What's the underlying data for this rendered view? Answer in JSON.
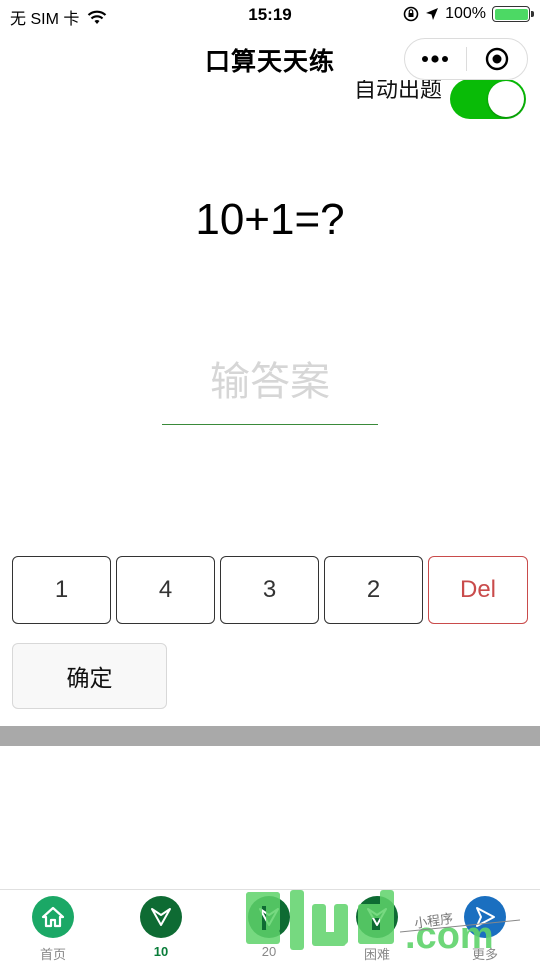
{
  "status_bar": {
    "carrier": "无 SIM 卡",
    "time": "15:19",
    "battery": "100%"
  },
  "nav": {
    "title": "口算天天练"
  },
  "auto_toggle": {
    "label": "自动出题",
    "on": true
  },
  "question": "10+1=?",
  "answer": {
    "value": "",
    "placeholder": "输答案"
  },
  "keypad": {
    "keys": [
      "1",
      "4",
      "3",
      "2"
    ],
    "del": "Del"
  },
  "confirm_label": "确定",
  "tabs": [
    {
      "label": "首页",
      "icon": "home-icon",
      "color": "#1ba866"
    },
    {
      "label": "10",
      "icon": "arrow-down-icon",
      "color": "#0e6b33"
    },
    {
      "label": "20",
      "icon": "arrow-down-icon",
      "color": "#0e6b33"
    },
    {
      "label": "困难",
      "icon": "arrow-down-icon",
      "color": "#0e6b33"
    },
    {
      "label": "更多",
      "icon": "send-icon",
      "color": "#1a6fc0"
    }
  ],
  "active_tab": "10",
  "watermark": {
    "text": ".com",
    "handwriting": "小程序"
  },
  "colors": {
    "switch_on": "#09bb07",
    "del_red": "#c94b4b",
    "underline": "#3a8a3a",
    "watermark_green": "#5fd36b"
  }
}
